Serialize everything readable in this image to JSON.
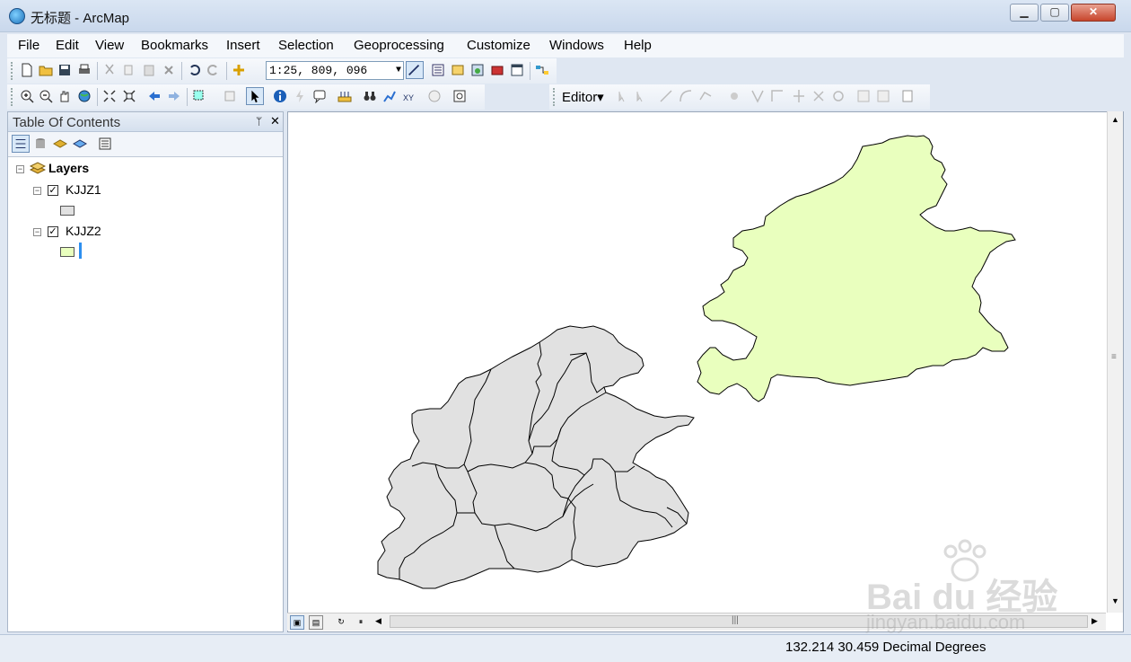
{
  "window": {
    "title": "无标题 - ArcMap",
    "minimize": "▁",
    "maximize": "▢",
    "close": "✕"
  },
  "menu": [
    "File",
    "Edit",
    "View",
    "Bookmarks",
    "Insert",
    "Selection",
    "Geoprocessing",
    "Customize",
    "Windows",
    "Help"
  ],
  "toolbar": {
    "scale_value": "1:25, 809, 096",
    "editor_label": "Editor▾"
  },
  "toc": {
    "title": "Table Of Contents",
    "pin": "ᛘ",
    "close": "✕",
    "root_label": "Layers",
    "layers": [
      {
        "name": "KJJZ1",
        "checked": true,
        "fill": "#e1e1e1"
      },
      {
        "name": "KJJZ2",
        "checked": true,
        "fill": "#e9ffbe"
      }
    ]
  },
  "map": {
    "colors": {
      "layer1": "#e1e1e1",
      "layer2": "#e9ffbe",
      "outline": "#000000"
    }
  },
  "status": {
    "coordinates": "132.214  30.459 Decimal Degrees"
  },
  "watermark": {
    "text": "Bai du 经验",
    "url": "jingyan.baidu.com"
  }
}
